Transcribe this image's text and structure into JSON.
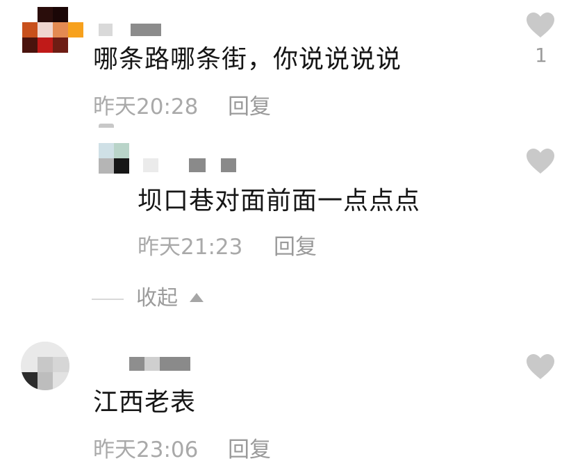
{
  "comments": [
    {
      "text": "哪条路哪条街，你说说说说",
      "time": "昨天20:28",
      "reply_label": "回复",
      "like_count": "1",
      "like_icon": "heart-icon"
    },
    {
      "text": "坝口巷对面前面一点点点",
      "time": "昨天21:23",
      "reply_label": "回复",
      "like_icon": "heart-icon"
    },
    {
      "text": "江西老表",
      "time": "昨天23:06",
      "reply_label": "回复",
      "like_icon": "heart-icon"
    }
  ],
  "collapse": {
    "label": "收起",
    "icon": "caret-up-icon"
  },
  "colors": {
    "text": "#161616",
    "meta": "#a9a9a9",
    "heart": "#c9c9c9"
  }
}
